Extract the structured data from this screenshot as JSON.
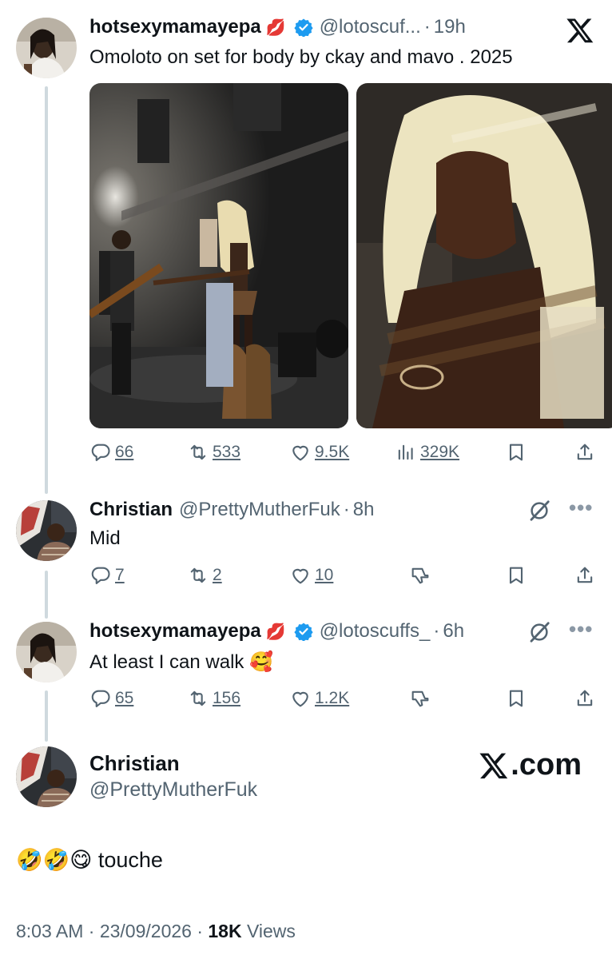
{
  "tweets": [
    {
      "name": "hotsexymamayepa",
      "name_emoji": "💋",
      "handle": "@lotoscuf...",
      "time": "19h",
      "text": "Omoloto on set for body by ckay and mavo . 2025",
      "verified": true,
      "stats": {
        "replies": "66",
        "reposts": "533",
        "likes": "9.5K",
        "views": "329K"
      }
    },
    {
      "name": "Christian",
      "handle": "@PrettyMutherFuk",
      "time": "8h",
      "text": "Mid",
      "stats": {
        "replies": "7",
        "reposts": "2",
        "likes": "10"
      }
    },
    {
      "name": "hotsexymamayepa",
      "name_emoji": "💋",
      "handle": "@lotoscuffs_",
      "time": "6h",
      "text": "At least I can walk 🥰",
      "verified": true,
      "stats": {
        "replies": "65",
        "reposts": "156",
        "likes": "1.2K"
      }
    }
  ],
  "main_reply": {
    "name": "Christian",
    "handle": "@PrettyMutherFuk",
    "text": "🤣🤣😋 touche",
    "timestamp": "8:03 AM · 23/09/2026 · ",
    "views_count": "18K",
    "views_label": " Views"
  },
  "watermark": {
    "text": ".com"
  },
  "separator": "·",
  "colors": {
    "accent": "#1d9bf0",
    "muted": "#536471",
    "text": "#0f1419",
    "thread": "#cfd9de"
  }
}
